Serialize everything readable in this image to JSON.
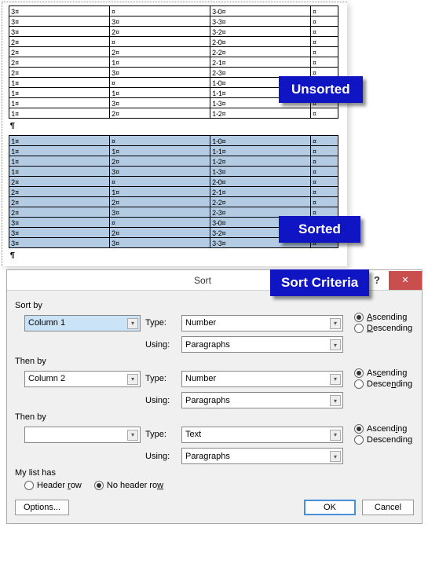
{
  "labels": {
    "unsorted": "Unsorted",
    "sorted": "Sorted",
    "criteria": "Sort Criteria"
  },
  "pilcrow": "¶",
  "unsorted_rows": [
    [
      "3¤",
      "¤",
      "3·0¤",
      "¤"
    ],
    [
      "3¤",
      "3¤",
      "3·3¤",
      "¤"
    ],
    [
      "3¤",
      "2¤",
      "3·2¤",
      "¤"
    ],
    [
      "2¤",
      "¤",
      "2·0¤",
      "¤"
    ],
    [
      "2¤",
      "2¤",
      "2·2¤",
      "¤"
    ],
    [
      "2¤",
      "1¤",
      "2·1¤",
      "¤"
    ],
    [
      "2¤",
      "3¤",
      "2·3¤",
      "¤"
    ],
    [
      "1¤",
      "¤",
      "1·0¤",
      "¤"
    ],
    [
      "1¤",
      "1¤",
      "1·1¤",
      "¤"
    ],
    [
      "1¤",
      "3¤",
      "1·3¤",
      "¤"
    ],
    [
      "1¤",
      "2¤",
      "1·2¤",
      "¤"
    ]
  ],
  "sorted_rows": [
    [
      "1¤",
      "¤",
      "1·0¤",
      "¤"
    ],
    [
      "1¤",
      "1¤",
      "1·1¤",
      "¤"
    ],
    [
      "1¤",
      "2¤",
      "1·2¤",
      "¤"
    ],
    [
      "1¤",
      "3¤",
      "1·3¤",
      "¤"
    ],
    [
      "2¤",
      "¤",
      "2·0¤",
      "¤"
    ],
    [
      "2¤",
      "1¤",
      "2·1¤",
      "¤"
    ],
    [
      "2¤",
      "2¤",
      "2·2¤",
      "¤"
    ],
    [
      "2¤",
      "3¤",
      "2·3¤",
      "¤"
    ],
    [
      "3¤",
      "¤",
      "3·0¤",
      "¤"
    ],
    [
      "3¤",
      "2¤",
      "3·2¤",
      "¤"
    ],
    [
      "3¤",
      "3¤",
      "3·3¤",
      "¤"
    ]
  ],
  "dialog": {
    "title": "Sort",
    "close": "✕",
    "help": "?",
    "sort_by": "Sort by",
    "then_by": "Then by",
    "type": "Type:",
    "using": "Using:",
    "ascending": "Ascending",
    "descending": "Descending",
    "my_list_has": "My list has",
    "header_row": "Header row",
    "no_header_row": "No header row",
    "options": "Options...",
    "ok": "OK",
    "cancel": "Cancel",
    "level1": {
      "field": "Column 1",
      "type": "Number",
      "using": "Paragraphs"
    },
    "level2": {
      "field": "Column 2",
      "type": "Number",
      "using": "Paragraphs"
    },
    "level3": {
      "field": "",
      "type": "Text",
      "using": "Paragraphs"
    }
  }
}
